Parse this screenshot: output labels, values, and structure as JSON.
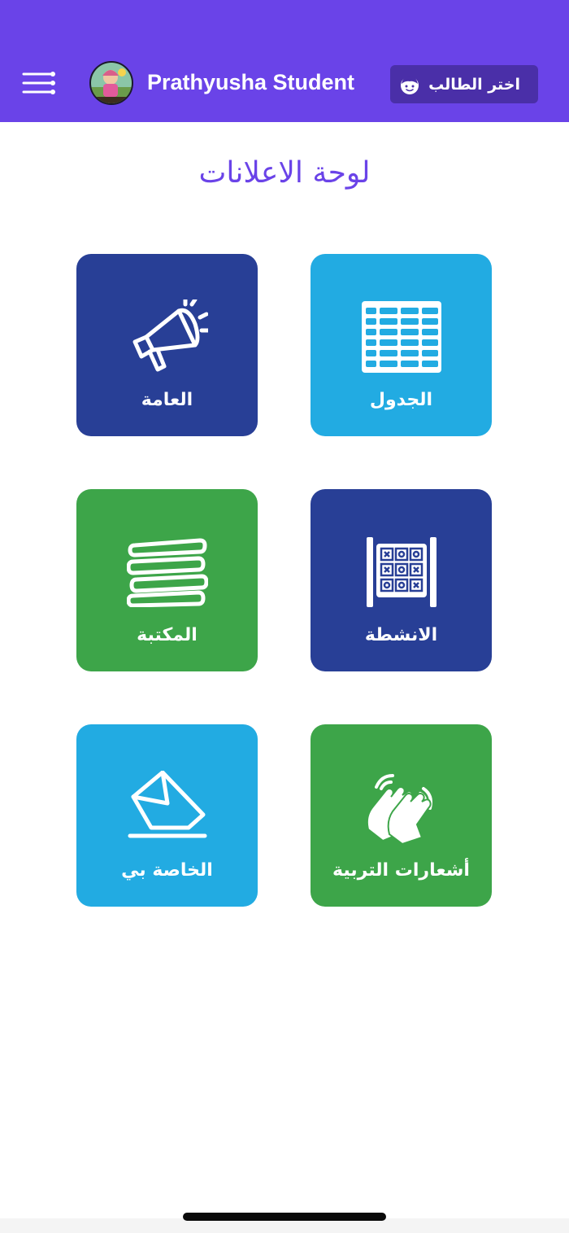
{
  "header": {
    "app_title": "Prathyusha Student",
    "select_student_label": "اختر الطالب",
    "menu_icon": "hamburger-menu-icon",
    "avatar_icon": "student-avatar",
    "select_icon": "kid-face-icon",
    "background_color": "#6a43e8",
    "button_color": "#4a2fa8"
  },
  "page": {
    "title": "لوحة الاعلانات",
    "title_color": "#6a43e8"
  },
  "tiles": [
    {
      "label": "الجدول",
      "icon": "timetable-icon",
      "color": "#22abe2"
    },
    {
      "label": "العامة",
      "icon": "megaphone-icon",
      "color": "#283f96"
    },
    {
      "label": "الانشطة",
      "icon": "activities-icon",
      "color": "#283f96"
    },
    {
      "label": "المكتبة",
      "icon": "books-icon",
      "color": "#3da549"
    },
    {
      "label": "أشعارات التربية",
      "icon": "clapping-hands-icon",
      "color": "#3da549"
    },
    {
      "label": "الخاصة بي",
      "icon": "envelope-icon",
      "color": "#22abe2"
    }
  ]
}
